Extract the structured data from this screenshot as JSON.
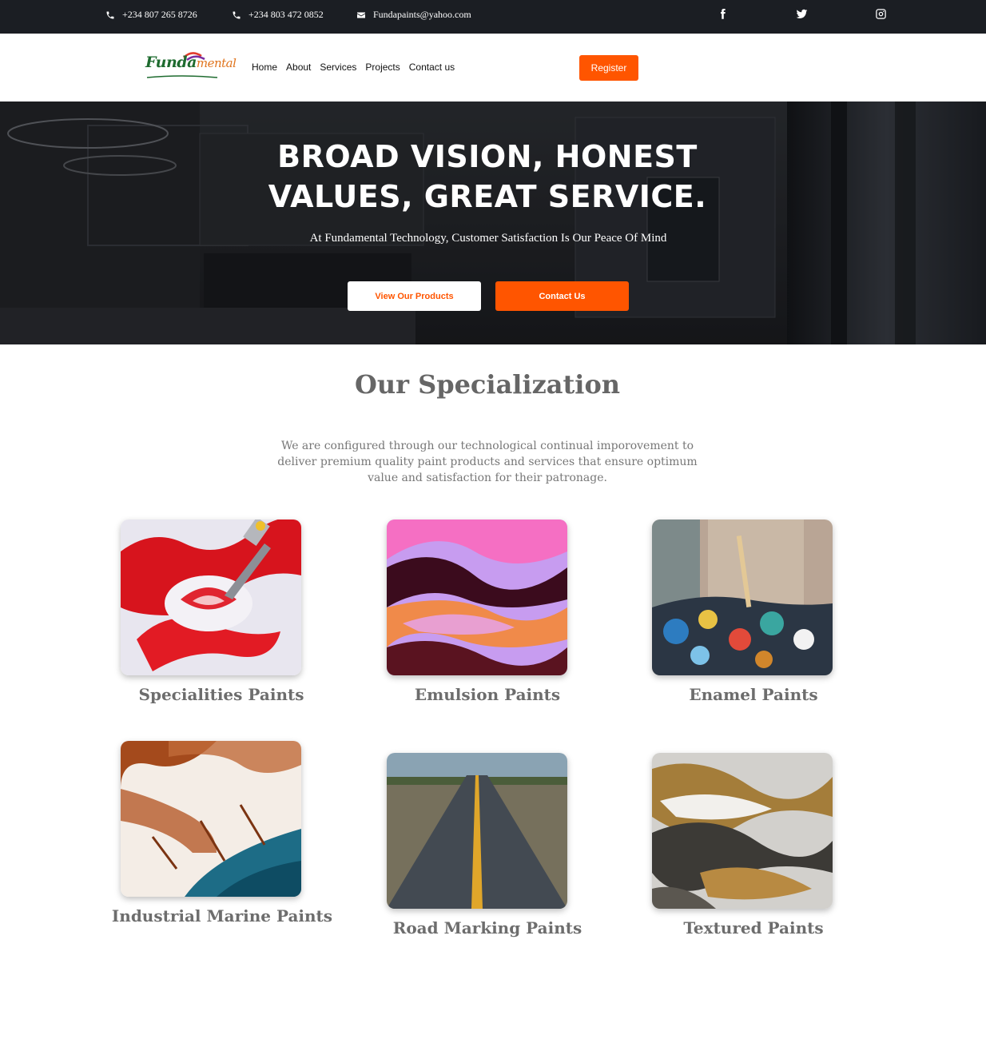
{
  "topbar": {
    "phone1": "+234 807 265 8726",
    "phone2": "+234 803 472 0852",
    "email": "Fundapaints@yahoo.com",
    "phone_icon": "phone-icon",
    "mail_icon": "mail-icon",
    "social": [
      "facebook-icon",
      "twitter-icon",
      "instagram-icon"
    ]
  },
  "nav": {
    "logo_part1": "Funda",
    "logo_part2": "mental",
    "links": [
      "Home",
      "About",
      "Services",
      "Projects",
      "Contact us"
    ],
    "register": "Register"
  },
  "hero": {
    "title_line1": "BROAD VISION, HONEST",
    "title_line2": "VALUES, GREAT SERVICE.",
    "subtitle": "At Fundamental Technology, Customer Satisfaction Is Our Peace Of Mind",
    "btn_products": "View Our Products",
    "btn_contact": "Contact Us"
  },
  "specialization": {
    "title": "Our Specialization",
    "description": "We are configured through our technological continual imporovement to deliver premium quality paint products and services that ensure optimum value and satisfaction for their patronage.",
    "cards": [
      {
        "label": "Specialities Paints"
      },
      {
        "label": "Emulsion Paints"
      },
      {
        "label": "Enamel Paints"
      },
      {
        "label": "Industrial Marine Paints"
      },
      {
        "label": "Road Marking Paints"
      },
      {
        "label": "Textured Paints"
      }
    ]
  },
  "colors": {
    "accent": "#ff5500",
    "topbar": "#1b1e23",
    "heading": "#666666"
  }
}
